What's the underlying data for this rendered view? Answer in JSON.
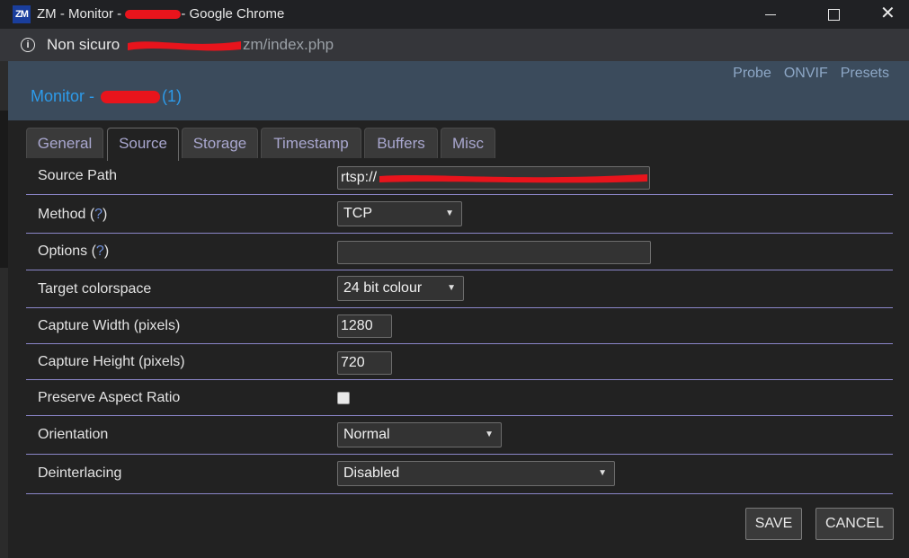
{
  "window": {
    "title_prefix": "ZM - Monitor - ",
    "title_suffix": "- Google Chrome",
    "favicon_text": "ZM",
    "close_glyph": "✕"
  },
  "addressbar": {
    "security_label": "Non sicuro",
    "info_glyph": "i",
    "url_path": "zm/index.php"
  },
  "header": {
    "links": [
      "Probe",
      "ONVIF",
      "Presets"
    ],
    "title_prefix": "Monitor - ",
    "title_suffix": "(1)"
  },
  "tabs": [
    {
      "label": "General",
      "active": false
    },
    {
      "label": "Source",
      "active": true
    },
    {
      "label": "Storage",
      "active": false
    },
    {
      "label": "Timestamp",
      "active": false
    },
    {
      "label": "Buffers",
      "active": false
    },
    {
      "label": "Misc",
      "active": false
    }
  ],
  "form": {
    "source_path": {
      "label": "Source Path",
      "value": "rtsp://"
    },
    "method": {
      "label": "Method (",
      "help": "?",
      "label_end": ")",
      "value": "TCP"
    },
    "options": {
      "label": "Options (",
      "help": "?",
      "label_end": ")",
      "value": ""
    },
    "target_colorspace": {
      "label": "Target colorspace",
      "value": "24 bit colour"
    },
    "capture_width": {
      "label": "Capture Width (pixels)",
      "value": "1280"
    },
    "capture_height": {
      "label": "Capture Height (pixels)",
      "value": "720"
    },
    "preserve_aspect": {
      "label": "Preserve Aspect Ratio",
      "checked": false
    },
    "orientation": {
      "label": "Orientation",
      "value": "Normal"
    },
    "deinterlacing": {
      "label": "Deinterlacing",
      "value": "Disabled"
    }
  },
  "buttons": {
    "save": "SAVE",
    "cancel": "CANCEL"
  },
  "caret_glyph": "▼",
  "colors": {
    "accent_title": "#2d9bea",
    "header_bg": "#3b4b5c",
    "tab_text": "#a9a7cf",
    "row_divider": "#8b86c9",
    "redaction": "#e8141c"
  }
}
